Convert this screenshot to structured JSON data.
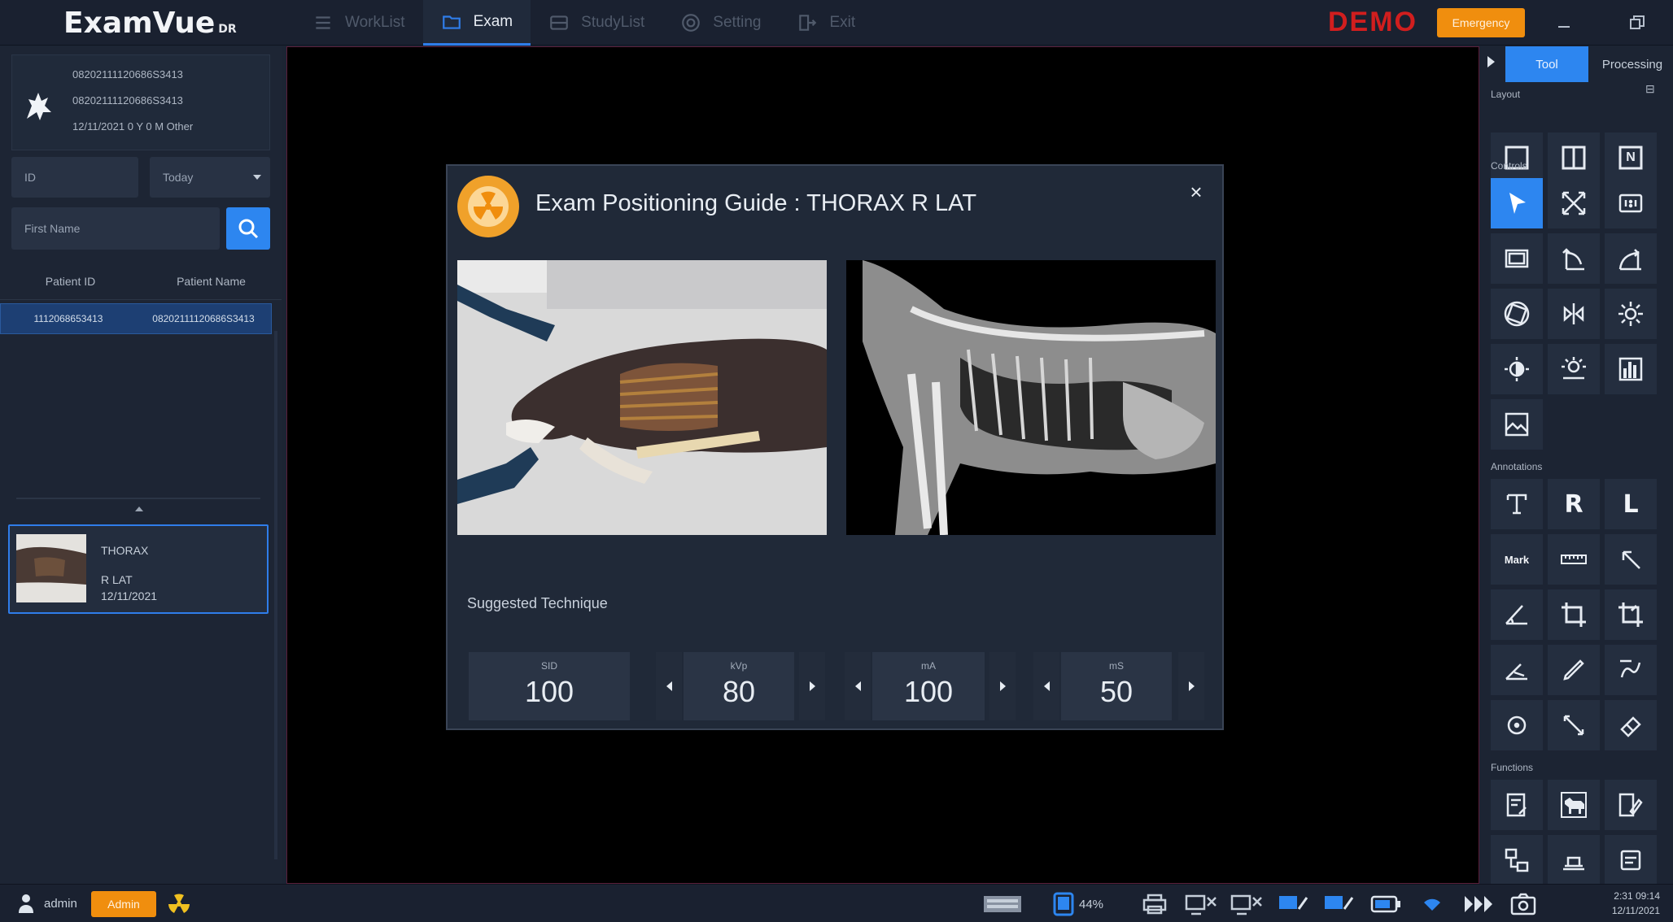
{
  "app": {
    "logo_text": "ExamVue",
    "logo_suffix": "DR",
    "demo_label": "DEMO",
    "emergency_label": "Emergency"
  },
  "nav": {
    "items": [
      {
        "label": "WorkList",
        "icon": "list-icon",
        "active": false
      },
      {
        "label": "Exam",
        "icon": "folder-icon",
        "active": true
      },
      {
        "label": "StudyList",
        "icon": "database-icon",
        "active": false
      },
      {
        "label": "Setting",
        "icon": "gear-icon",
        "active": false
      },
      {
        "label": "Exit",
        "icon": "exit-icon",
        "active": false
      }
    ]
  },
  "patient": {
    "line1": "08202111120686S3413",
    "line2": "08202111120686S3413",
    "line3": "12/11/2021 0 Y 0 M Other"
  },
  "filters": {
    "id_placeholder": "ID",
    "date_value": "Today",
    "name_placeholder": "First Name"
  },
  "list": {
    "headers": [
      "Patient ID",
      "Patient Name"
    ],
    "rows": [
      [
        "1112068653413",
        "08202111120686S3413"
      ]
    ]
  },
  "exam_item": {
    "title": "THORAX",
    "position": "R LAT",
    "date": "12/11/2021"
  },
  "modal": {
    "title": "Exam Positioning Guide : THORAX R LAT",
    "close_symbol": "×",
    "suggested_label": "Suggested Technique",
    "technique": [
      {
        "label": "SID",
        "value": "100"
      },
      {
        "label": "kVp",
        "value": "80"
      },
      {
        "label": "mA",
        "value": "100"
      },
      {
        "label": "mS",
        "value": "50"
      }
    ]
  },
  "right_panel": {
    "tabs": [
      "Tool",
      "Processing"
    ],
    "sections": {
      "layout": "Layout",
      "controls": "Controls",
      "annotations": "Annotations",
      "functions": "Functions"
    },
    "layout_badge": "N",
    "text_tools": {
      "r": "R",
      "l": "L",
      "mark": "Mark"
    }
  },
  "statusbar": {
    "user": "admin",
    "role": "Admin",
    "battery_pct": "44%",
    "time": "2:31 09:14",
    "date": "12/11/2021"
  },
  "colors": {
    "accent": "#2d86f0",
    "orange": "#f08e0e",
    "demo_red": "#d11e1e"
  }
}
